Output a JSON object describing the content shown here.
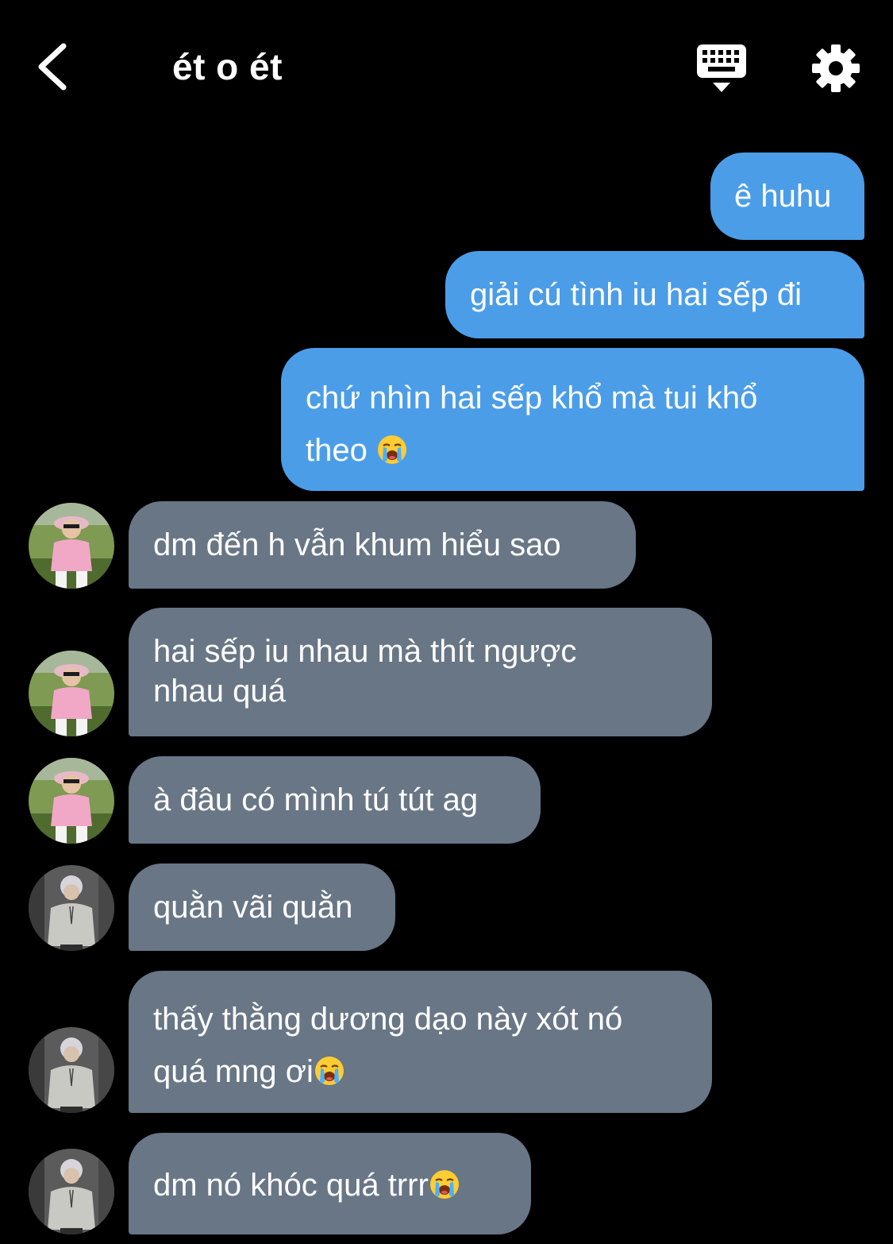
{
  "header": {
    "title": "ét o ét",
    "back_icon": "chevron-left-icon",
    "keyboard_icon": "keyboard-hide-icon",
    "settings_icon": "gear-icon"
  },
  "colors": {
    "background": "#000000",
    "sent_bubble": "#4b9de8",
    "received_bubble": "#687686",
    "text": "#ffffff"
  },
  "messages": [
    {
      "direction": "sent",
      "lines": [
        "ê huhu"
      ]
    },
    {
      "direction": "sent",
      "lines": [
        "giải cú tình iu hai sếp đi"
      ]
    },
    {
      "direction": "sent",
      "lines": [
        "chứ nhìn hai sếp khổ mà tui khổ",
        "theo"
      ],
      "emoji": "loudly-crying-face"
    },
    {
      "direction": "received",
      "avatar": "pink-shirt-avatar",
      "lines": [
        "dm đến h vẫn khum hiểu sao"
      ]
    },
    {
      "direction": "received",
      "avatar": "pink-shirt-avatar",
      "lines": [
        "hai sếp iu nhau mà thít ngược",
        "nhau quá"
      ]
    },
    {
      "direction": "received",
      "avatar": "pink-shirt-avatar",
      "lines": [
        "à đâu có mình tú tút ag"
      ]
    },
    {
      "direction": "received",
      "avatar": "grey-hoodie-avatar",
      "lines": [
        "quằn vãi quằn"
      ]
    },
    {
      "direction": "received",
      "avatar": "grey-hoodie-avatar",
      "lines": [
        "thấy thằng dương dạo này xót nó",
        "quá mng ơi"
      ],
      "emoji": "loudly-crying-face"
    },
    {
      "direction": "received",
      "avatar": "grey-hoodie-avatar",
      "lines": [
        "dm nó khóc quá trrr"
      ],
      "emoji": "loudly-crying-face"
    }
  ]
}
